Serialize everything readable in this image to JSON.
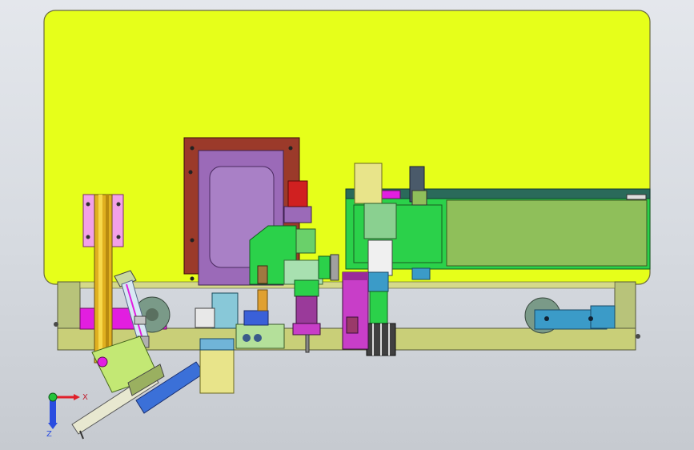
{
  "viewport": {
    "axis_x_label": "X",
    "axis_z_label": "Z"
  },
  "colors": {
    "background_top": "#e4e7ec",
    "panel_fill": "#e6ff1a",
    "frame_fill": "#c9cf78",
    "purple_housing": "#9b6ab8",
    "brown_plate": "#9b3a2a",
    "green_block": "#2bd14a",
    "conveyor_green": "#8fbf5a",
    "cyan_block": "#3b9bc8",
    "magenta": "#e21ee0",
    "axis_x": "#e0202a",
    "axis_y": "#25c43a",
    "axis_z": "#2a4de0"
  }
}
